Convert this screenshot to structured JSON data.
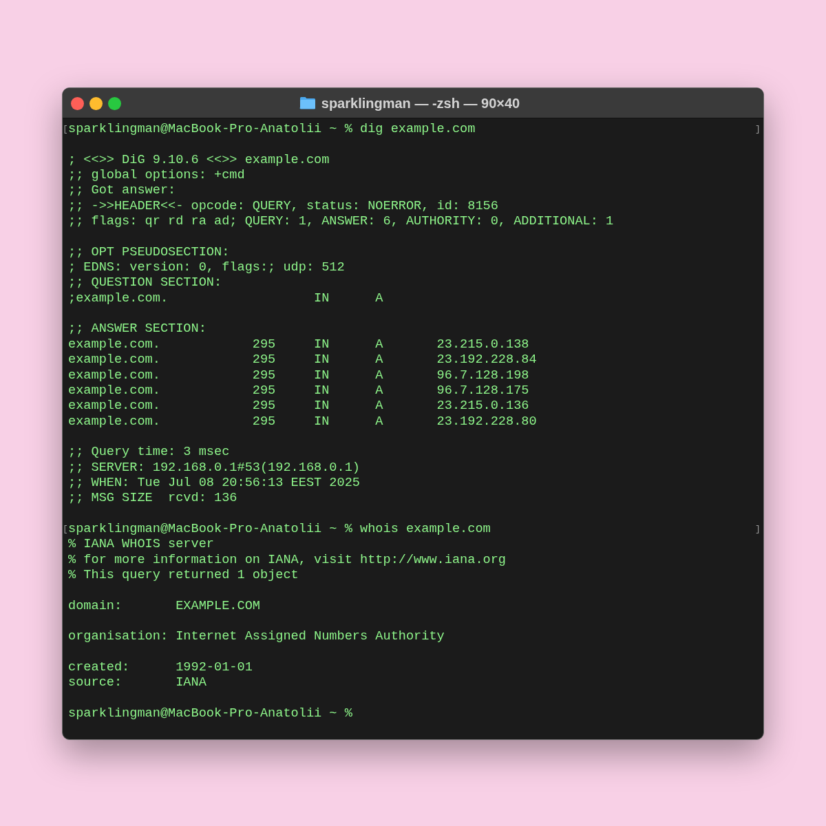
{
  "window": {
    "title": "sparklingman — -zsh — 90×40"
  },
  "lines": [
    {
      "kind": "prompt",
      "open_mark": "[",
      "text": "sparklingman@MacBook-Pro-Anatolii ~ % dig example.com",
      "close_mark": "]"
    },
    {
      "kind": "blank"
    },
    {
      "kind": "output",
      "text": "; <<>> DiG 9.10.6 <<>> example.com"
    },
    {
      "kind": "output",
      "text": ";; global options: +cmd"
    },
    {
      "kind": "output",
      "text": ";; Got answer:"
    },
    {
      "kind": "output",
      "text": ";; ->>HEADER<<- opcode: QUERY, status: NOERROR, id: 8156"
    },
    {
      "kind": "output",
      "text": ";; flags: qr rd ra ad; QUERY: 1, ANSWER: 6, AUTHORITY: 0, ADDITIONAL: 1"
    },
    {
      "kind": "blank"
    },
    {
      "kind": "output",
      "text": ";; OPT PSEUDOSECTION:"
    },
    {
      "kind": "output",
      "text": "; EDNS: version: 0, flags:; udp: 512"
    },
    {
      "kind": "output",
      "text": ";; QUESTION SECTION:"
    },
    {
      "kind": "output",
      "text": ";example.com.                   IN      A"
    },
    {
      "kind": "blank"
    },
    {
      "kind": "output",
      "text": ";; ANSWER SECTION:"
    },
    {
      "kind": "output",
      "text": "example.com.            295     IN      A       23.215.0.138"
    },
    {
      "kind": "output",
      "text": "example.com.            295     IN      A       23.192.228.84"
    },
    {
      "kind": "output",
      "text": "example.com.            295     IN      A       96.7.128.198"
    },
    {
      "kind": "output",
      "text": "example.com.            295     IN      A       96.7.128.175"
    },
    {
      "kind": "output",
      "text": "example.com.            295     IN      A       23.215.0.136"
    },
    {
      "kind": "output",
      "text": "example.com.            295     IN      A       23.192.228.80"
    },
    {
      "kind": "blank"
    },
    {
      "kind": "output",
      "text": ";; Query time: 3 msec"
    },
    {
      "kind": "output",
      "text": ";; SERVER: 192.168.0.1#53(192.168.0.1)"
    },
    {
      "kind": "output",
      "text": ";; WHEN: Tue Jul 08 20:56:13 EEST 2025"
    },
    {
      "kind": "output",
      "text": ";; MSG SIZE  rcvd: 136"
    },
    {
      "kind": "blank"
    },
    {
      "kind": "prompt",
      "open_mark": "[",
      "text": "sparklingman@MacBook-Pro-Anatolii ~ % whois example.com",
      "close_mark": "]"
    },
    {
      "kind": "output",
      "text": "% IANA WHOIS server"
    },
    {
      "kind": "output",
      "text": "% for more information on IANA, visit http://www.iana.org"
    },
    {
      "kind": "output",
      "text": "% This query returned 1 object"
    },
    {
      "kind": "blank"
    },
    {
      "kind": "output",
      "text": "domain:       EXAMPLE.COM"
    },
    {
      "kind": "blank"
    },
    {
      "kind": "output",
      "text": "organisation: Internet Assigned Numbers Authority"
    },
    {
      "kind": "blank"
    },
    {
      "kind": "output",
      "text": "created:      1992-01-01"
    },
    {
      "kind": "output",
      "text": "source:       IANA"
    },
    {
      "kind": "blank"
    },
    {
      "kind": "prompt",
      "text": "sparklingman@MacBook-Pro-Anatolii ~ %"
    }
  ]
}
